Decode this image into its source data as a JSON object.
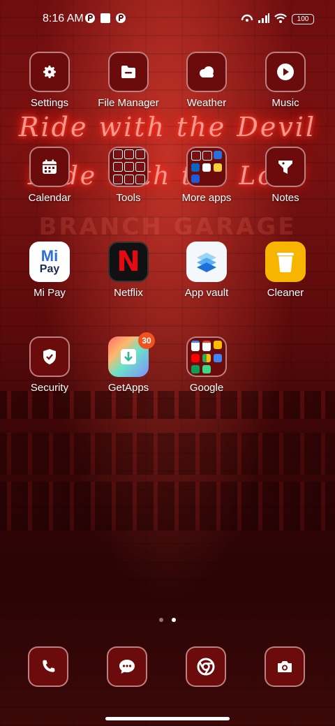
{
  "status_bar": {
    "time": "8:16 AM",
    "battery": "100",
    "icons": [
      "notification-app-icon",
      "square-notification-icon",
      "notification-app-icon",
      "hotspot-icon",
      "signal-icon",
      "wifi-icon",
      "battery-icon"
    ]
  },
  "wallpaper": {
    "neon_line_1": "Ride with the Devil",
    "neon_line_2": "Hide with the Lord",
    "sign_line_1": "BRANCH GARAGE"
  },
  "apps": [
    {
      "label": "Settings",
      "icon": "gear-icon"
    },
    {
      "label": "File Manager",
      "icon": "folder-icon"
    },
    {
      "label": "Weather",
      "icon": "cloud-icon"
    },
    {
      "label": "Music",
      "icon": "play-icon"
    },
    {
      "label": "Calendar",
      "icon": "calendar-icon"
    },
    {
      "label": "Tools",
      "icon": "folder-icon"
    },
    {
      "label": "More apps",
      "icon": "folder-icon"
    },
    {
      "label": "Notes",
      "icon": "note-icon"
    },
    {
      "label": "Mi Pay",
      "icon": "mi-pay-icon",
      "icon_text_1": "Mi",
      "icon_text_2": "Pay"
    },
    {
      "label": "Netflix",
      "icon": "netflix-icon",
      "icon_text": "N"
    },
    {
      "label": "App vault",
      "icon": "app-vault-icon"
    },
    {
      "label": "Cleaner",
      "icon": "trash-icon"
    },
    {
      "label": "Security",
      "icon": "shield-icon"
    },
    {
      "label": "GetApps",
      "icon": "getapps-icon",
      "badge": "30"
    },
    {
      "label": "Google",
      "icon": "folder-icon"
    }
  ],
  "dock": [
    {
      "name": "Phone",
      "icon": "phone-icon"
    },
    {
      "name": "Messages",
      "icon": "message-icon"
    },
    {
      "name": "Chrome",
      "icon": "chrome-icon"
    },
    {
      "name": "Camera",
      "icon": "camera-icon"
    }
  ],
  "colors": {
    "tile_bg": "#6b0b0c",
    "badge": "#f0521e",
    "mipay_blue": "#2a6fdb",
    "netflix_red": "#e50914",
    "cleaner_yellow": "#f7b500"
  },
  "pager": {
    "pages": 2,
    "current": 2
  }
}
